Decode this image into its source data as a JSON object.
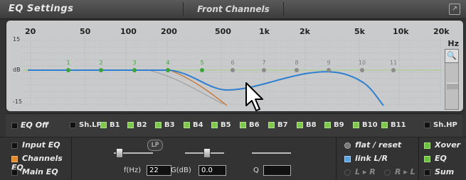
{
  "title": {
    "left": "EQ Settings",
    "center": "Front Channels",
    "corner_icon": "expand-icon"
  },
  "graph": {
    "freq_labels": [
      "20",
      "50",
      "100",
      "200",
      "500",
      "1k",
      "2k",
      "5k",
      "10k",
      "20k"
    ],
    "y_labels": {
      "top": "15",
      "mid": "dB",
      "bottom": "-15"
    },
    "hz_label": "Hz",
    "band_points": [
      "1",
      "2",
      "3",
      "4",
      "5",
      "6",
      "7",
      "8",
      "9",
      "10",
      "11"
    ],
    "colors": {
      "bg": "#c9cacb",
      "curve": "#2e7fd0",
      "lp_curve": "#c8702a",
      "active_point": "#39a33a",
      "inactive_point": "#8a8a8a"
    }
  },
  "bands": {
    "eq_off": "EQ Off",
    "items": [
      {
        "label": "Sh.LP",
        "on": false
      },
      {
        "label": "B1",
        "on": true
      },
      {
        "label": "B2",
        "on": true
      },
      {
        "label": "B3",
        "on": true
      },
      {
        "label": "B4",
        "on": true
      },
      {
        "label": "B5",
        "on": true
      },
      {
        "label": "B6",
        "on": true
      },
      {
        "label": "B7",
        "on": true
      },
      {
        "label": "B8",
        "on": true
      },
      {
        "label": "B9",
        "on": true
      },
      {
        "label": "B10",
        "on": true
      },
      {
        "label": "B11",
        "on": true
      },
      {
        "label": "Sh.HP",
        "on": false
      }
    ]
  },
  "left_panel": {
    "items": [
      "Input EQ",
      "Channels EQ",
      "Main EQ"
    ]
  },
  "filter": {
    "badge": "LP",
    "freq_label": "f(Hz)",
    "freq_value": "22",
    "gain_label": "G(dB)",
    "gain_value": "0.0",
    "q_label": "Q",
    "q_value": ""
  },
  "right_panel": {
    "flat": "flat / reset",
    "link": "link L/R",
    "lr": "L ▸ R",
    "rl": "R ▸ L"
  },
  "far_right": {
    "items": [
      "Xover",
      "EQ",
      "Sum"
    ]
  }
}
